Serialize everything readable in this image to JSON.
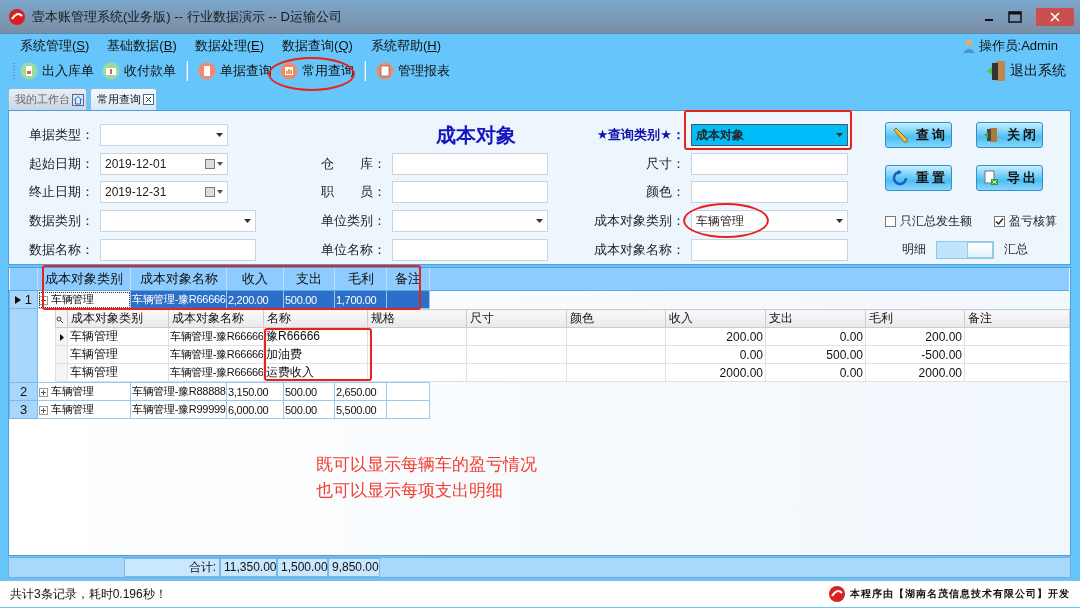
{
  "window": {
    "title": "壹本账管理系统(业务版) -- 行业数据演示 -- D运输公司"
  },
  "menu": [
    "系统管理(S)",
    "基础数据(B)",
    "数据处理(E)",
    "数据查询(Q)",
    "系统帮助(H)"
  ],
  "operator": "操作员:Admin",
  "toolbar": [
    [
      {
        "label": "出入库单",
        "kind": "inout"
      },
      {
        "label": "收付款单",
        "kind": "payment"
      }
    ],
    [
      {
        "label": "单据查询",
        "kind": "document"
      },
      {
        "label": "常用查询",
        "kind": "chart"
      }
    ],
    [
      {
        "label": "管理报表",
        "kind": "report"
      }
    ]
  ],
  "exit": "退出系统",
  "tabs": [
    {
      "label": "我的工作台",
      "kind": "home",
      "selected": false
    },
    {
      "label": "常用查询",
      "kind": "closable",
      "selected": true
    }
  ],
  "form": {
    "title": "成本对象",
    "columns": [
      [
        {
          "label": "单据类型：",
          "kind": "dropdown",
          "highlighted": false
        },
        {
          "label": "起始日期：",
          "kind": "date",
          "value": "2019-12-01",
          "highlighted": false
        },
        {
          "label": "终止日期：",
          "kind": "date",
          "value": "2019-12-31",
          "highlighted": false
        },
        {
          "label": "数据类别：",
          "kind": "dropdown",
          "highlighted": false
        },
        {
          "label": "数据名称：",
          "kind": "text",
          "highlighted": false
        }
      ],
      [
        {
          "label": "仓　　库：",
          "kind": "text",
          "highlighted": false
        },
        {
          "label": "职　　员：",
          "kind": "text",
          "highlighted": false
        },
        {
          "label": "单位类别：",
          "kind": "dropdown",
          "highlighted": false
        },
        {
          "label": "单位名称：",
          "kind": "text",
          "highlighted": false
        }
      ],
      [
        {
          "label": "★查询类别★：",
          "kind": "dropdown",
          "value": "成本对象",
          "highlighted": true
        },
        {
          "label": "尺寸：",
          "kind": "text",
          "highlighted": false
        },
        {
          "label": "颜色：",
          "kind": "text",
          "highlighted": false
        },
        {
          "label": "成本对象类别：",
          "kind": "dropdown",
          "value": "车辆管理",
          "highlighted": false
        },
        {
          "label": "成本对象名称：",
          "kind": "text",
          "highlighted": false
        }
      ]
    ],
    "buttons": [
      {
        "label": "查 询",
        "kind": "pencil"
      },
      {
        "label": "关 闭",
        "kind": "door"
      },
      {
        "label": "重 置",
        "kind": "refresh"
      },
      {
        "label": "导 出",
        "kind": "export"
      }
    ],
    "options": [
      {
        "label": "只汇总发生额",
        "checked": false
      },
      {
        "label": "盈亏核算",
        "checked": true
      }
    ],
    "view_switch": {
      "left": "明细",
      "right": "汇总",
      "on": true
    }
  },
  "grid": {
    "columns": [
      "成本对象类别",
      "成本对象名称",
      "收入",
      "支出",
      "毛利",
      "备注"
    ],
    "rows": [
      {
        "index": "1",
        "selected": true,
        "expanded": true,
        "cells": [
          "车辆管理",
          "车辆管理-豫R66666",
          "2,200.00",
          "500.00",
          "1,700.00",
          null
        ],
        "detail": {
          "columns": [
            "成本对象类别",
            "成本对象名称",
            "名称",
            "规格",
            "尺寸",
            "颜色",
            "收入",
            "支出",
            "毛利",
            "备注"
          ],
          "rows": [
            {
              "current": true,
              "cells": [
                "车辆管理",
                "车辆管理-豫R66666",
                "豫R66666",
                null,
                null,
                null,
                "200.00",
                "0.00",
                "200.00",
                null
              ]
            },
            {
              "current": false,
              "cells": [
                "车辆管理",
                "车辆管理-豫R66666",
                "加油费",
                null,
                null,
                null,
                "0.00",
                "500.00",
                "-500.00",
                null
              ]
            },
            {
              "current": false,
              "cells": [
                "车辆管理",
                "车辆管理-豫R66666",
                "运费收入",
                null,
                null,
                null,
                "2000.00",
                "0.00",
                "2000.00",
                null
              ]
            }
          ]
        }
      },
      {
        "index": "2",
        "selected": false,
        "expanded": false,
        "cells": [
          "车辆管理",
          "车辆管理-豫R88888",
          "3,150.00",
          "500.00",
          "2,650.00",
          null
        ]
      },
      {
        "index": "3",
        "selected": false,
        "expanded": false,
        "cells": [
          "车辆管理",
          "车辆管理-豫R99999",
          "6,000.00",
          "500.00",
          "5,500.00",
          null
        ]
      }
    ]
  },
  "totals": {
    "label": "合计:",
    "values": [
      "11,350.00",
      "1,500.00",
      "9,850.00"
    ]
  },
  "status": {
    "message": "共计3条记录，耗时0.196秒！",
    "credit": "本程序由【湖南名茂信息技术有限公司】开发"
  },
  "note": [
    "既可以显示每辆车的盈亏情况",
    "也可以显示每项支出明细"
  ]
}
